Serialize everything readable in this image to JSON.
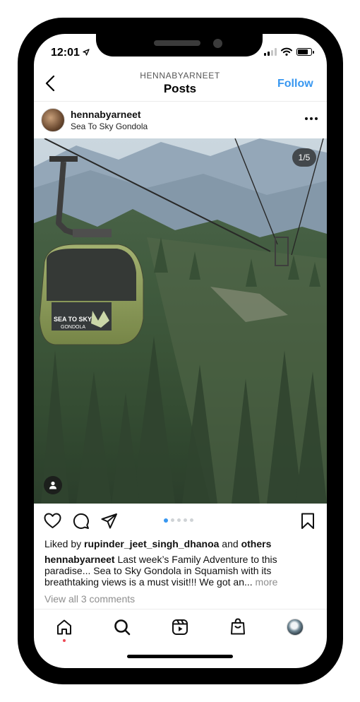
{
  "status_bar": {
    "time": "12:01"
  },
  "header": {
    "username": "HENNABYARNEET",
    "title": "Posts",
    "follow_label": "Follow"
  },
  "post": {
    "username": "hennabyarneet",
    "location": "Sea To Sky Gondola",
    "image_counter": "1/5",
    "gondola_sign": "SEA TO SKY",
    "gondola_sign_sub": "GONDOLA",
    "carousel_total": 5,
    "carousel_active": 1
  },
  "likes": {
    "prefix": "Liked by ",
    "user": "rupinder_jeet_singh_dhanoa",
    "middle": " and ",
    "others": "others"
  },
  "caption": {
    "user": "hennabyarneet",
    "text": " Last week’s Family Adventure to this paradise... Sea to Sky Gondola in Squamish with its breathtaking views is a must visit!!! We got an...",
    "more": " more"
  },
  "comments_link": "View all 3 comments",
  "colors": {
    "accent": "#3897f0",
    "notification": "#ed4956"
  },
  "icons": {
    "back": "chevron-left-icon",
    "options": "more-horizontal-icon",
    "like": "heart-icon",
    "comment": "comment-icon",
    "share": "paper-plane-icon",
    "save": "bookmark-icon",
    "tags": "person-icon",
    "tabs": [
      "home-icon",
      "search-icon",
      "reels-icon",
      "shop-icon",
      "profile-avatar"
    ]
  }
}
